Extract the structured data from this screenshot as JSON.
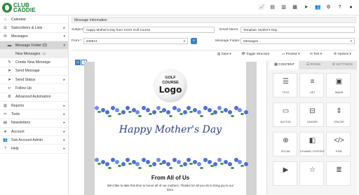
{
  "brand": {
    "name_line1": "CLUB",
    "name_line2": "CADDIE"
  },
  "topbar": {
    "icons": [
      "chart-icon",
      "file-icon",
      "file-icon",
      "chart-icon",
      "send-icon",
      "users-icon",
      "settings-icon",
      "help-icon",
      "user-icon"
    ]
  },
  "sidebar": {
    "items": [
      {
        "label": "Calendar",
        "icon": "home-icon"
      },
      {
        "label": "Subscribers & Lists",
        "icon": "list-icon"
      },
      {
        "label": "Messages",
        "icon": "envelope-icon"
      },
      {
        "label": "Message Folder (0)",
        "icon": "folder-icon"
      },
      {
        "label": "New Messages",
        "icon": "folder-icon"
      },
      {
        "label": "Create New Message",
        "icon": "pencil-icon"
      },
      {
        "label": "Send Message",
        "icon": "send-icon"
      },
      {
        "label": "Send Status",
        "icon": "send-icon"
      },
      {
        "label": "Follow Up",
        "icon": "reply-icon"
      },
      {
        "label": "Advanced Automation",
        "icon": "gear-icon"
      },
      {
        "label": "Reports",
        "icon": "chart-icon"
      },
      {
        "label": "Tools",
        "icon": "wrench-icon"
      },
      {
        "label": "Newsletters",
        "icon": "newspaper-icon"
      },
      {
        "label": "Account",
        "icon": "user-icon"
      },
      {
        "label": "Sub Account Admin",
        "icon": "users-icon"
      },
      {
        "label": "Help",
        "icon": "help-icon"
      }
    ],
    "new_messages_badge": "0"
  },
  "form": {
    "header": "Message Information",
    "subject_label": "Subject:",
    "subject_value": "Happy Mother's Day from XXXX Golf Course",
    "from_label": "From *",
    "from_value": "245913",
    "email_name_label": "Email Name:",
    "email_name_value": "Template: Mother's Day",
    "folder_label": "Message Folder:",
    "folder_value": "Messages"
  },
  "toolbar": {
    "save": "Save",
    "toggle": "Toggle Structure",
    "preview": "Preview",
    "test": "Test",
    "options": "Options"
  },
  "email": {
    "logo_line1": "GOLF",
    "logo_line2": "COURSE",
    "logo_line3": "Logo",
    "headline": "Happy Mother's Day",
    "from_all": "From All of Us",
    "body": "We'd like to take this time to honor all of our mothers. Thanks for all you do to bring joy to our lives."
  },
  "panel": {
    "tabs": [
      "CONTENT",
      "ROWS",
      "SETTINGS"
    ],
    "tiles": [
      {
        "label": "TITLE",
        "icon": "title-icon",
        "glyph": "☰"
      },
      {
        "label": "LIST",
        "icon": "list-icon",
        "glyph": "≡"
      },
      {
        "label": "IMAGE",
        "icon": "image-icon",
        "glyph": "▣"
      },
      {
        "label": "BUTTON",
        "icon": "button-icon",
        "glyph": "▭"
      },
      {
        "label": "DIVIDER",
        "icon": "divider-icon",
        "glyph": "⊟"
      },
      {
        "label": "SPACER",
        "icon": "spacer-icon",
        "glyph": "⇕"
      },
      {
        "label": "SOCIAL",
        "icon": "social-icon",
        "glyph": "⊕"
      },
      {
        "label": "DYNAMIC CONTENT",
        "icon": "dynamic-icon",
        "glyph": "◧"
      },
      {
        "label": "HTML",
        "icon": "html-icon",
        "glyph": "</>"
      },
      {
        "label": "",
        "icon": "video-icon",
        "glyph": "▶"
      },
      {
        "label": "",
        "icon": "icons-icon",
        "glyph": "☆"
      },
      {
        "label": "",
        "icon": "menu-icon",
        "glyph": "≣"
      }
    ]
  },
  "colors": {
    "brand_green": "#1d7a30",
    "accent_blue": "#3b80c8",
    "headline_blue": "#2e3d83",
    "flower_blue": "#4f6fd6"
  }
}
